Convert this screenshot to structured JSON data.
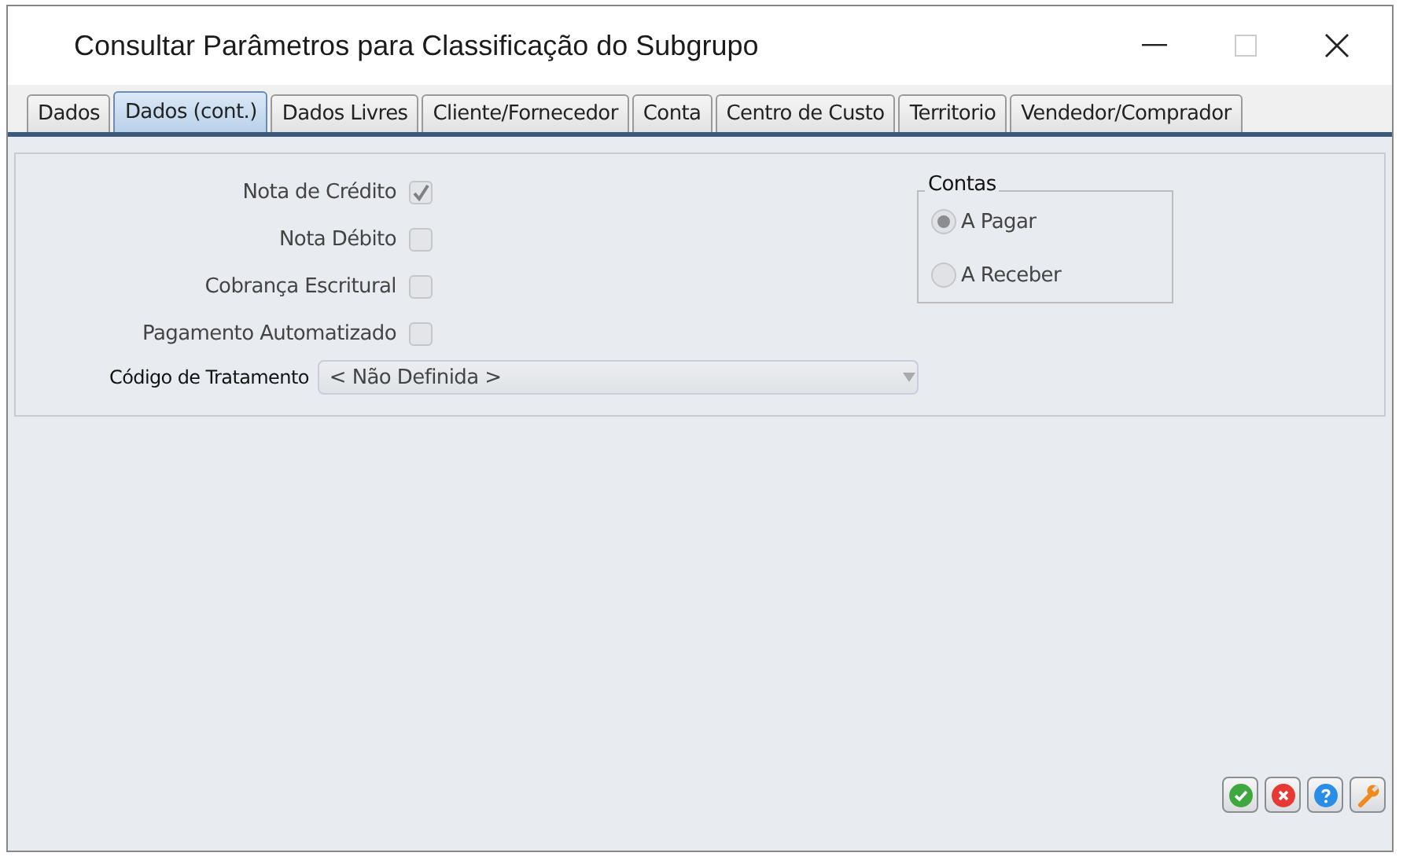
{
  "window": {
    "title": "Consultar Parâmetros para Classificação do Subgrupo"
  },
  "tabs": [
    {
      "label": "Dados",
      "selected": false
    },
    {
      "label": "Dados (cont.)",
      "selected": true
    },
    {
      "label": "Dados Livres",
      "selected": false
    },
    {
      "label": "Cliente/Fornecedor",
      "selected": false
    },
    {
      "label": "Conta",
      "selected": false
    },
    {
      "label": "Centro de Custo",
      "selected": false
    },
    {
      "label": "Territorio",
      "selected": false
    },
    {
      "label": "Vendedor/Comprador",
      "selected": false
    }
  ],
  "checkboxes": [
    {
      "label": "Nota de Crédito",
      "checked": true
    },
    {
      "label": "Nota Débito",
      "checked": false
    },
    {
      "label": "Cobrança Escritural",
      "checked": false
    },
    {
      "label": "Pagamento Automatizado",
      "checked": false
    }
  ],
  "codigo_tratamento": {
    "label": "Código de Tratamento",
    "value": "< Não Definida >"
  },
  "contas": {
    "title": "Contas",
    "options": [
      {
        "label": "A Pagar",
        "selected": true
      },
      {
        "label": "A Receber",
        "selected": false
      }
    ]
  }
}
